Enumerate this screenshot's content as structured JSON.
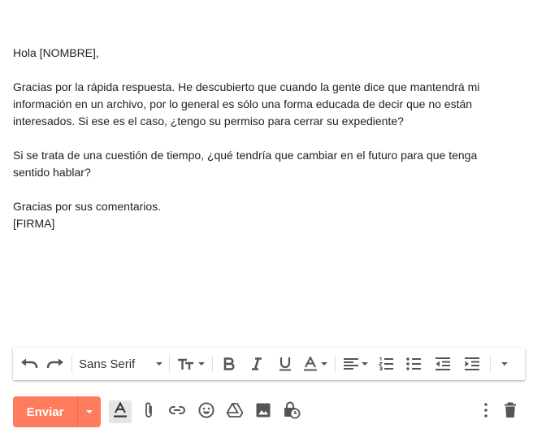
{
  "message": {
    "greeting": "Hola [NOMBRE],",
    "paragraph1": "Gracias por la rápida respuesta. He descubierto que cuando la gente dice que mantendrá mi información en un archivo, por lo general es sólo una forma educada de decir que no están interesados. Si ese es el caso, ¿tengo su permiso para cerrar su expediente?",
    "paragraph2": "Si se trata de una cuestión de tiempo, ¿qué tendría que cambiar en el futuro para que tenga sentido hablar?",
    "closing": "Gracias por sus comentarios.",
    "signature": "[FIRMA]"
  },
  "toolbar": {
    "font_family": "Sans Serif",
    "icons": [
      "undo-icon",
      "redo-icon",
      "text-size-icon",
      "bold-icon",
      "italic-icon",
      "underline-icon",
      "text-color-icon",
      "align-icon",
      "numbered-list-icon",
      "bulleted-list-icon",
      "indent-less-icon",
      "indent-more-icon",
      "more-formatting-icon"
    ]
  },
  "actions": {
    "send_label": "Enviar",
    "icons": [
      "formatting-options-icon",
      "attach-icon",
      "link-icon",
      "emoji-icon",
      "drive-icon",
      "photo-icon",
      "confidential-mode-icon",
      "more-options-icon",
      "discard-icon"
    ]
  },
  "colors": {
    "send": "#fe7b5c",
    "icon": "#444444",
    "text": "#222222"
  }
}
